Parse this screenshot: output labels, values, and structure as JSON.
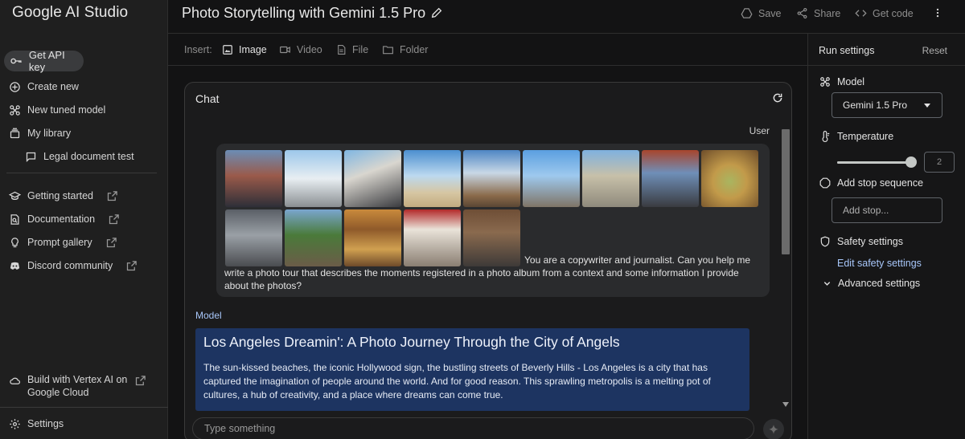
{
  "app": {
    "brand": "Google AI Studio"
  },
  "sidebar": {
    "api_key": "Get API key",
    "items": [
      {
        "label": "Create new",
        "icon": "add-circle-icon"
      },
      {
        "label": "New tuned model",
        "icon": "tune-icon"
      },
      {
        "label": "My library",
        "icon": "library-icon"
      },
      {
        "label": "Legal document test",
        "icon": "chat-bubble-icon"
      }
    ],
    "links": [
      {
        "label": "Getting started",
        "icon": "graduation-icon"
      },
      {
        "label": "Documentation",
        "icon": "doc-search-icon"
      },
      {
        "label": "Prompt gallery",
        "icon": "lightbulb-icon"
      },
      {
        "label": "Discord community",
        "icon": "discord-icon"
      }
    ],
    "vertex": "Build with Vertex AI on Google Cloud",
    "settings": "Settings"
  },
  "topbar": {
    "title": "Photo Storytelling with Gemini 1.5 Pro",
    "save": "Save",
    "share": "Share",
    "get_code": "Get code"
  },
  "insert": {
    "label": "Insert:",
    "items": [
      "Image",
      "Video",
      "File",
      "Folder"
    ]
  },
  "chat": {
    "title": "Chat",
    "user_label": "User",
    "user_text": "You are a copywriter and journalist. Can you help me write a photo tour that describes the moments registered in a photo album from a context and some information I provide about the photos?",
    "model_label": "Model",
    "model_heading": "Los Angeles Dreamin': A Photo Journey Through the City of Angels",
    "model_text": "The sun-kissed beaches, the iconic Hollywood sign, the bustling streets of Beverly Hills - Los Angeles is a city that has captured the imagination of people around the world. And for good reason. This sprawling metropolis is a melting pot of cultures, a hub of creativity, and a place where dreams can come true.",
    "input_placeholder": "Type something"
  },
  "run_settings": {
    "title": "Run settings",
    "reset": "Reset",
    "model_label": "Model",
    "model_value": "Gemini 1.5 Pro",
    "temperature_label": "Temperature",
    "temperature_value": "2",
    "temperature_fraction": 1.0,
    "stop_label": "Add stop sequence",
    "stop_placeholder": "Add stop...",
    "safety_label": "Safety settings",
    "safety_link": "Edit safety settings",
    "advanced_label": "Advanced settings"
  },
  "colors": {
    "accent": "#a8c7fa",
    "model_bubble": "#1d3461",
    "background": "#131314"
  }
}
